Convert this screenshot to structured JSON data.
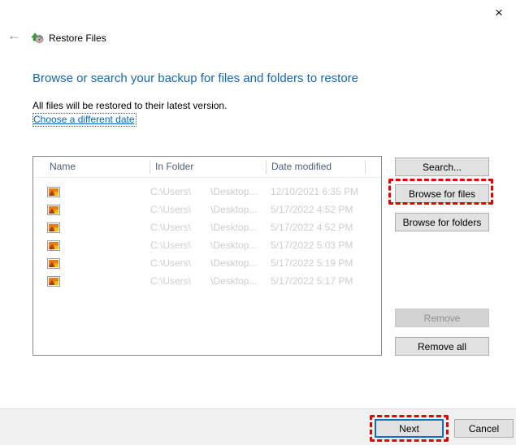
{
  "window": {
    "close_glyph": "×"
  },
  "nav": {
    "back_glyph": "←",
    "title": "Restore Files"
  },
  "header": {
    "heading": "Browse or search your backup for files and folders to restore",
    "description": "All files will be restored to their latest version.",
    "date_link": "Choose a different date"
  },
  "table": {
    "columns": [
      "Name",
      "In Folder",
      "Date modified"
    ],
    "rows": [
      {
        "icon": "image-file-icon",
        "folder_prefix": "C:\\Users\\",
        "folder_redacted": true,
        "folder_suffix": "\\Desktop...",
        "date_modified": "12/10/2021 6:35 PM"
      },
      {
        "icon": "image-file-icon",
        "folder_prefix": "C:\\Users\\",
        "folder_redacted": true,
        "folder_suffix": "\\Desktop...",
        "date_modified": "5/17/2022 4:52 PM"
      },
      {
        "icon": "image-file-icon",
        "folder_prefix": "C:\\Users\\",
        "folder_redacted": true,
        "folder_suffix": "\\Desktop...",
        "date_modified": "5/17/2022 4:52 PM"
      },
      {
        "icon": "image-file-icon",
        "folder_prefix": "C:\\Users\\",
        "folder_redacted": true,
        "folder_suffix": "\\Desktop...",
        "date_modified": "5/17/2022 5:03 PM"
      },
      {
        "icon": "image-file-icon",
        "folder_prefix": "C:\\Users\\",
        "folder_redacted": true,
        "folder_suffix": "\\Desktop...",
        "date_modified": "5/17/2022 5:19 PM"
      },
      {
        "icon": "image-file-icon",
        "folder_prefix": "C:\\Users\\",
        "folder_redacted": true,
        "folder_suffix": "\\Desktop...",
        "date_modified": "5/17/2022 5:17 PM"
      }
    ]
  },
  "side_buttons": {
    "search": "Search...",
    "browse_files": "Browse for files",
    "browse_folders": "Browse for folders",
    "remove": "Remove",
    "remove_all": "Remove all"
  },
  "footer": {
    "next": "Next",
    "cancel": "Cancel"
  },
  "colors": {
    "heading_blue": "#1567b8",
    "link_blue": "#0066cc",
    "annotation_red": "#e80000",
    "focus_border_blue": "#0672c6",
    "disabled_text": "#8f8f8f",
    "row_text_gray": "#cdcdcd",
    "footer_gray": "#f0f0f0"
  }
}
